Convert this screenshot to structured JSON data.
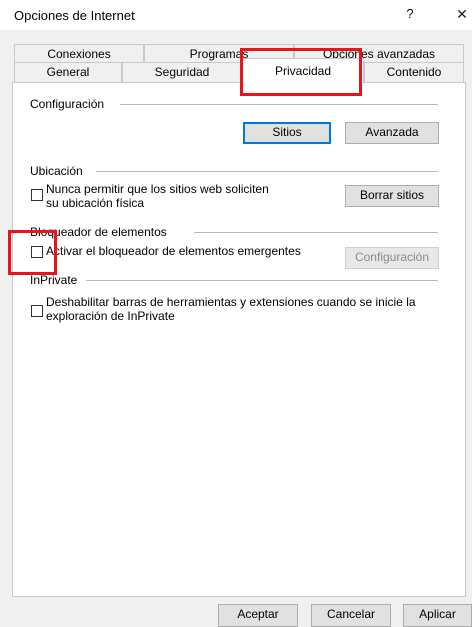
{
  "window": {
    "title": "Opciones de Internet",
    "help": "?",
    "close": "✕"
  },
  "tabs_row1": [
    "Conexiones",
    "Programas",
    "Opciones avanzadas"
  ],
  "tabs_row2": [
    "General",
    "Seguridad",
    "Privacidad",
    "Contenido"
  ],
  "active_tab": "Privacidad",
  "config": {
    "label": "Configuración",
    "sites_button": "Sitios",
    "advanced_button": "Avanzada"
  },
  "location": {
    "label": "Ubicación",
    "checkbox_line1": "Nunca permitir que los sitios web soliciten",
    "checkbox_line2": "su ubicación física",
    "clear_button": "Borrar sitios"
  },
  "popup": {
    "label": "Bloqueador de elementos",
    "checkbox": "Activar el bloqueador de elementos emergentes",
    "settings_button": "Configuración"
  },
  "inprivate": {
    "label": "InPrivate",
    "checkbox_line1": "Deshabilitar barras de herramientas y extensiones cuando se inicie la",
    "checkbox_line2": "exploración de InPrivate"
  },
  "footer": {
    "ok": "Aceptar",
    "cancel": "Cancelar",
    "apply": "Aplicar"
  },
  "colors": {
    "highlight": "#e8141b",
    "focus": "#0078d7"
  }
}
